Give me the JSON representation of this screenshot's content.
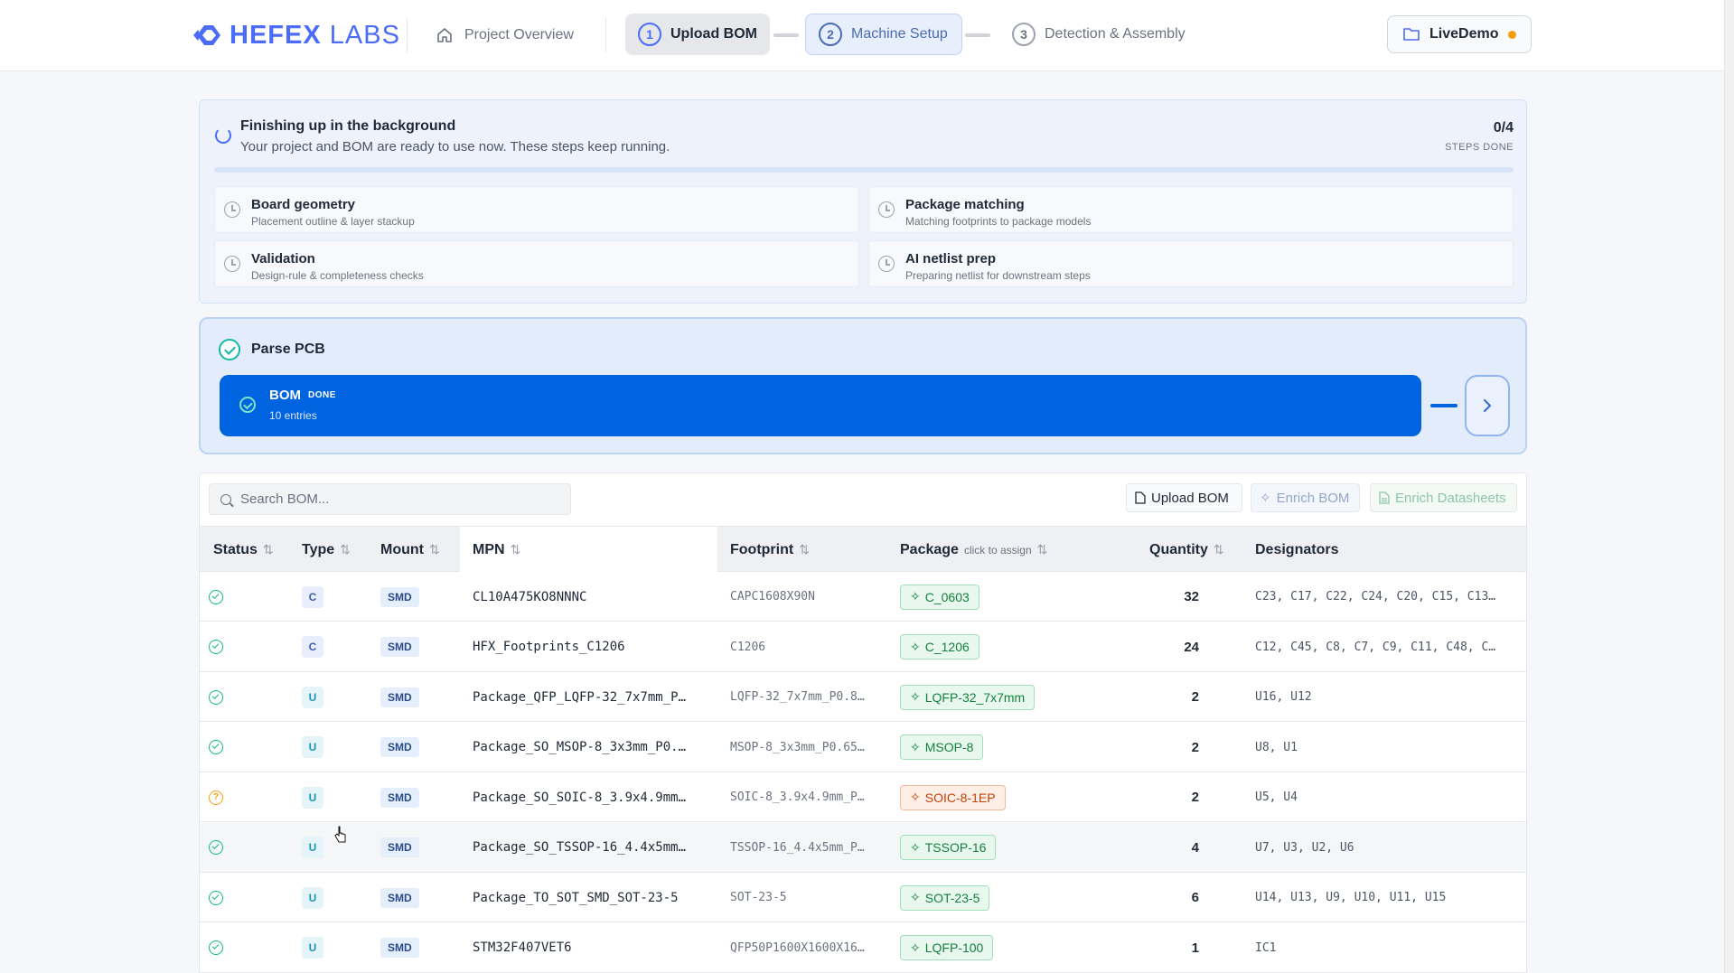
{
  "header": {
    "logo_bold": "HEFEX",
    "logo_light": "LABS",
    "nav_overview": "Project Overview",
    "steps": [
      {
        "num": "1",
        "label": "Upload BOM"
      },
      {
        "num": "2",
        "label": "Machine Setup"
      },
      {
        "num": "3",
        "label": "Detection & Assembly"
      }
    ],
    "project_button": "LiveDemo",
    "accent": "#4a6cf7"
  },
  "background_tasks": {
    "title": "Finishing up in the background",
    "subtitle": "Your project and BOM are ready to use now. These steps keep running.",
    "count": "0/4",
    "count_label": "STEPS DONE",
    "progress": 0,
    "tasks": [
      {
        "title": "Board geometry",
        "subtitle": "Placement outline & layer stackup"
      },
      {
        "title": "Package matching",
        "subtitle": "Matching footprints to package models"
      },
      {
        "title": "Validation",
        "subtitle": "Design-rule & completeness checks"
      },
      {
        "title": "AI netlist prep",
        "subtitle": "Preparing netlist for downstream steps"
      }
    ]
  },
  "parse": {
    "title": "Parse PCB",
    "bom_title": "BOM",
    "bom_status": "DONE",
    "bom_sub": "10 entries",
    "next_icon": "chevron-right-icon"
  },
  "table": {
    "search_placeholder": "Search BOM...",
    "buttons": {
      "upload": "Upload BOM",
      "enrich": "Enrich BOM",
      "datasheets": "Enrich Datasheets"
    },
    "columns": {
      "status": "Status",
      "type": "Type",
      "mount": "Mount",
      "mpn": "MPN",
      "footprint": "Footprint",
      "package": "Package",
      "package_hint": "click to assign",
      "quantity": "Quantity",
      "designators": "Designators"
    },
    "rows": [
      {
        "status": "ok",
        "type": "C",
        "mount": "SMD",
        "mpn": "CL10A475KO8NNNC",
        "footprint": "CAPC1608X90N",
        "package": "C_0603",
        "pkg_status": "ok",
        "quantity": "32",
        "designators": "C23, C17, C22, C24, C20, C15, C13…"
      },
      {
        "status": "ok",
        "type": "C",
        "mount": "SMD",
        "mpn": "HFX_Footprints_C1206",
        "footprint": "C1206",
        "package": "C_1206",
        "pkg_status": "ok",
        "quantity": "24",
        "designators": "C12, C45, C8, C7, C9, C11, C48, C…"
      },
      {
        "status": "ok",
        "type": "U",
        "mount": "SMD",
        "mpn": "Package_QFP_LQFP-32_7x7mm_P…",
        "footprint": "LQFP-32_7x7mm_P0.8…",
        "package": "LQFP-32_7x7mm",
        "pkg_status": "ok",
        "quantity": "2",
        "designators": "U16, U12"
      },
      {
        "status": "ok",
        "type": "U",
        "mount": "SMD",
        "mpn": "Package_SO_MSOP-8_3x3mm_P0.…",
        "footprint": "MSOP-8_3x3mm_P0.65…",
        "package": "MSOP-8",
        "pkg_status": "ok",
        "quantity": "2",
        "designators": "U8, U1"
      },
      {
        "status": "warn",
        "type": "U",
        "mount": "SMD",
        "mpn": "Package_SO_SOIC-8_3.9x4.9mm…",
        "footprint": "SOIC-8_3.9x4.9mm_P…",
        "package": "SOIC-8-1EP",
        "pkg_status": "warn",
        "quantity": "2",
        "designators": "U5, U4"
      },
      {
        "status": "ok",
        "type": "U",
        "mount": "SMD",
        "mpn": "Package_SO_TSSOP-16_4.4x5mm…",
        "footprint": "TSSOP-16_4.4x5mm_P…",
        "package": "TSSOP-16",
        "pkg_status": "ok",
        "quantity": "4",
        "designators": "U7, U3, U2, U6"
      },
      {
        "status": "ok",
        "type": "U",
        "mount": "SMD",
        "mpn": "Package_TO_SOT_SMD_SOT-23-5",
        "footprint": "SOT-23-5",
        "package": "SOT-23-5",
        "pkg_status": "ok",
        "quantity": "6",
        "designators": "U14, U13, U9, U10, U11, U15"
      },
      {
        "status": "ok",
        "type": "U",
        "mount": "SMD",
        "mpn": "STM32F407VET6",
        "footprint": "QFP50P1600X1600X16…",
        "package": "LQFP-100",
        "pkg_status": "ok",
        "quantity": "1",
        "designators": "IC1"
      }
    ]
  }
}
